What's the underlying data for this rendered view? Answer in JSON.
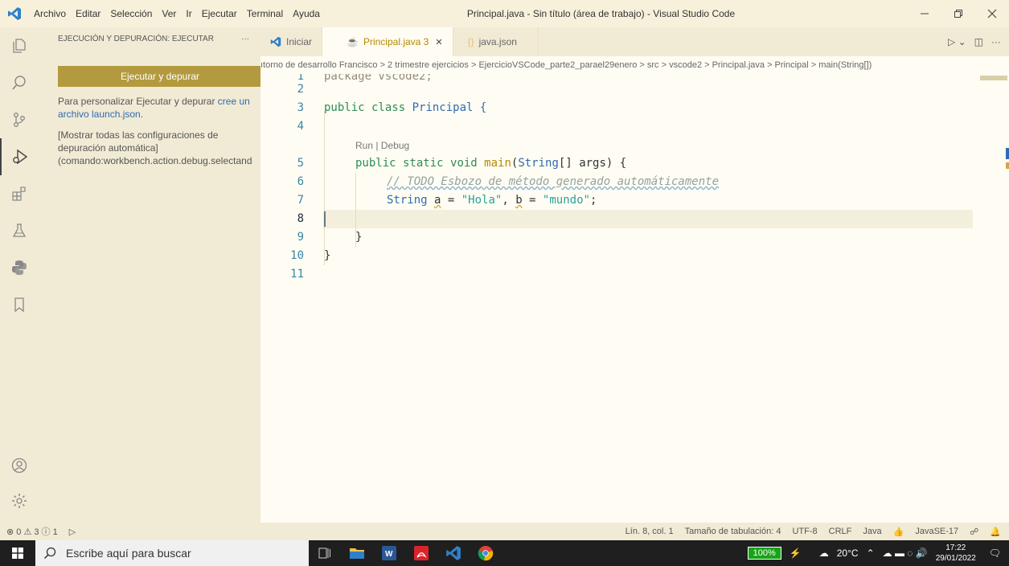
{
  "titlebar": {
    "menu": [
      "Archivo",
      "Editar",
      "Selección",
      "Ver",
      "Ir",
      "Ejecutar",
      "Terminal",
      "Ayuda"
    ],
    "window_title": "Principal.java - Sin título (área de trabajo) - Visual Studio Code"
  },
  "sidebar": {
    "header": "EJECUCIÓN Y DEPURACIÓN: EJECUTAR",
    "more": "···",
    "run_button": "Ejecutar y depurar",
    "text1": "Para personalizar Ejecutar y depurar",
    "link1": "cree un archivo launch.json.",
    "text2_line1": "[Mostrar todas las configuraciones de",
    "text2_line2": "depuración automática]",
    "text2_line3": "(comando:workbench.action.debug.selectand"
  },
  "tabs": [
    {
      "label": "Iniciar",
      "active": false
    },
    {
      "label": "Principal.java 3",
      "active": true
    },
    {
      "label": "java.json",
      "active": false
    }
  ],
  "breadcrumb": "ıtorno de desarrollo Francisco > 2 trimestre ejercicios > EjercicioVSCode_parte2_parael29enero > src > vscode2 > Principal.java > Principal > main(String[])",
  "editor": {
    "codelens": "Run | Debug",
    "line_numbers": [
      "1",
      "2",
      "3",
      "4",
      "5",
      "6",
      "7",
      "8",
      "9",
      "10",
      "11"
    ],
    "line1": "package vscode2;",
    "line3_kw": "public class",
    "line3_name": "Principal {",
    "line5_kw1": "public static",
    "line5_void": "void",
    "line5_main": "main",
    "line5_rest1": "(",
    "line5_string": "String",
    "line5_rest2": "[] args) {",
    "line6_comment": "// TODO Esbozo de método generado automáticamente",
    "line7_type": "String",
    "line7_a": "a",
    "line7_eq1": " = ",
    "line7_hola": "\"Hola\"",
    "line7_comma": ", ",
    "line7_b": "b",
    "line7_eq2": " = ",
    "line7_mundo": "\"mundo\"",
    "line7_end": ";",
    "line9": "}",
    "line10": "}"
  },
  "statusbar": {
    "problems": "⊗ 0 ⚠ 3 ⓘ 1",
    "position": "Lín. 8, col. 1",
    "tab_size": "Tamaño de tabulación: 4",
    "encoding": "UTF-8",
    "eol": "CRLF",
    "language": "Java",
    "jdk": "JavaSE-17"
  },
  "taskbar": {
    "search_placeholder": "Escribe aquí para buscar",
    "battery": "100%",
    "temperature": "20°C",
    "time": "17:22",
    "date": "29/01/2022"
  }
}
